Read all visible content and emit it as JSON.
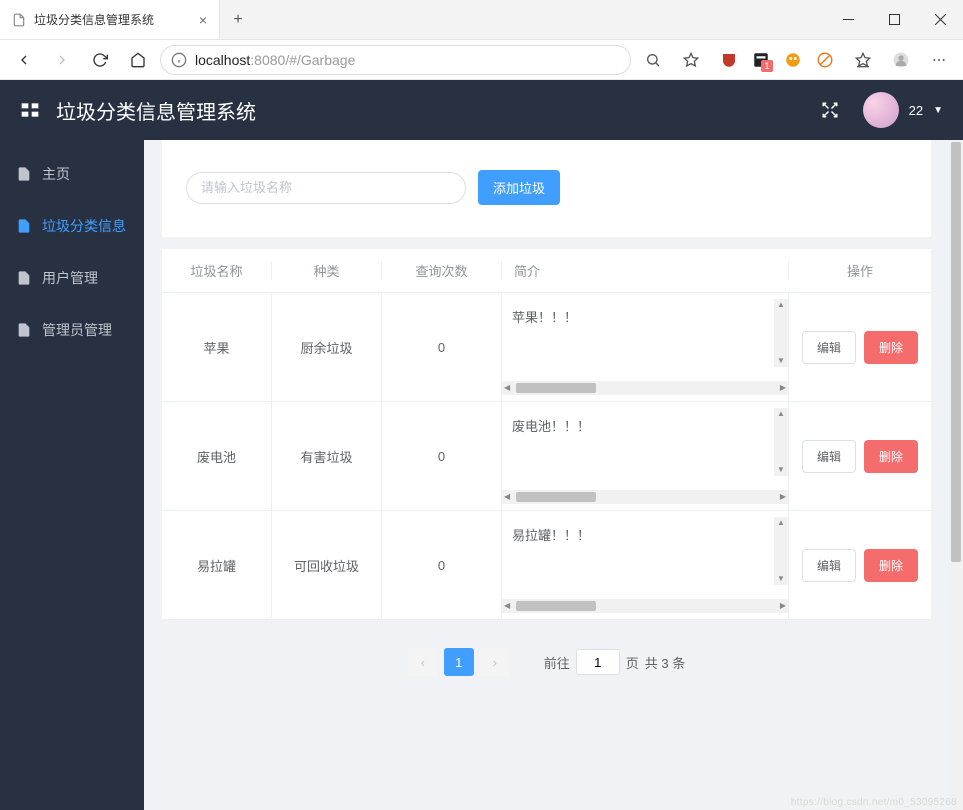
{
  "browser": {
    "tab_title": "垃圾分类信息管理系统",
    "url_host": "localhost",
    "url_port": ":8080",
    "url_path": "/#/Garbage",
    "ext_badge": "1"
  },
  "header": {
    "app_title": "垃圾分类信息管理系统",
    "user_label": "22"
  },
  "sidebar": {
    "items": [
      {
        "label": "主页"
      },
      {
        "label": "垃圾分类信息"
      },
      {
        "label": "用户管理"
      },
      {
        "label": "管理员管理"
      }
    ]
  },
  "search": {
    "placeholder": "请输入垃圾名称",
    "add_button": "添加垃圾"
  },
  "table": {
    "headers": {
      "name": "垃圾名称",
      "kind": "种类",
      "count": "查询次数",
      "desc": "简介",
      "ops": "操作"
    },
    "rows": [
      {
        "name": "苹果",
        "kind": "厨余垃圾",
        "count": "0",
        "desc": "苹果！！！"
      },
      {
        "name": "废电池",
        "kind": "有害垃圾",
        "count": "0",
        "desc": "废电池！！！"
      },
      {
        "name": "易拉罐",
        "kind": "可回收垃圾",
        "count": "0",
        "desc": "易拉罐！！！"
      }
    ],
    "edit_label": "编辑",
    "delete_label": "删除"
  },
  "pagination": {
    "current": "1",
    "jump_prefix": "前往",
    "jump_value": "1",
    "jump_suffix": "页",
    "total_text": "共 3 条"
  },
  "watermark": "https://blog.csdn.net/m0_53095268"
}
